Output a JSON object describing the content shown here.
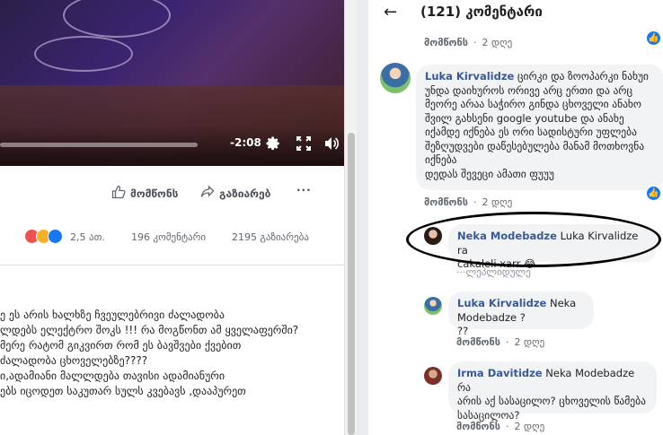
{
  "video": {
    "time": "-2:08"
  },
  "post_actions": {
    "like": "მომწონს",
    "share": "გაზიარებ",
    "more": "···"
  },
  "reactions": {
    "count": "2,5 ათ.",
    "comments": "196 კომენტარი",
    "shares": "2195 გაზიარება"
  },
  "post_text": [
    "ე ეს არის ხალხზე ჩვეულებრივი ძალადობა",
    "ლდებს ელექტრო შოკს !!! რა მოგწონთ ამ ყველაფერში?",
    "მერე რატომ გიკვირთ რომ ეს ბავშვები ქვებით",
    "ძალადობა ცხოველებზე????",
    "ი,ადამიანი მალლდება თავისი ადამიანური",
    "ებს იცოდეთ საკუთარ სულს კვებავს ,დააპურეთ"
  ],
  "panel": {
    "back": "←",
    "title": "(121) კომენტარი"
  },
  "top_meta": {
    "like": "მომწონს",
    "time": "2 დღე"
  },
  "comments": [
    {
      "name": "Luka Kirvalidze",
      "lines": [
        "ცირკი და ზოოპარკი ნახუი",
        "უნდა დაიხუროს ორივე არც ერთი და არც",
        "მეორე არაა საჭირო გინდა ცხოველი ანახო",
        "შვილ გახსენი google youtube და ანახე",
        "იქამდე იქნება ეს ორი სადისტური უფლება",
        "შეზღუდვები დაწესებულება მანამ მოთხოვნა",
        "იქნება",
        "დედას შევეცი ამათი ფუუუ"
      ],
      "meta_like": "მომწონს",
      "meta_time": "2 დღე"
    },
    {
      "name": "Neka Modebadze",
      "lines": [
        "Luka Kirvalidze ra",
        "cakaleli xarr 😂"
      ],
      "meta_like": "···ლეპლიდულე"
    },
    {
      "name": "Luka Kirvalidze",
      "lines": [
        "Neka Modebadze ?",
        "??"
      ],
      "meta_like": "მომწონს",
      "meta_time": "2 დღე"
    },
    {
      "name": "Irma Davitidze",
      "lines": [
        "Neka Modebadze რა",
        "არის აქ სასაცილო? ცხოველის წამება",
        "სასაცილოა?"
      ],
      "meta_like": "მომწონს",
      "meta_time": "2 დღე"
    }
  ],
  "colors": {
    "link": "#385898",
    "like_badge": "#1877f2",
    "bubble": "#f2f3f5"
  },
  "icons": [
    "settings-icon",
    "fullscreen-icon",
    "volume-icon",
    "thumbs-up-icon",
    "share-icon",
    "back-arrow-icon"
  ]
}
